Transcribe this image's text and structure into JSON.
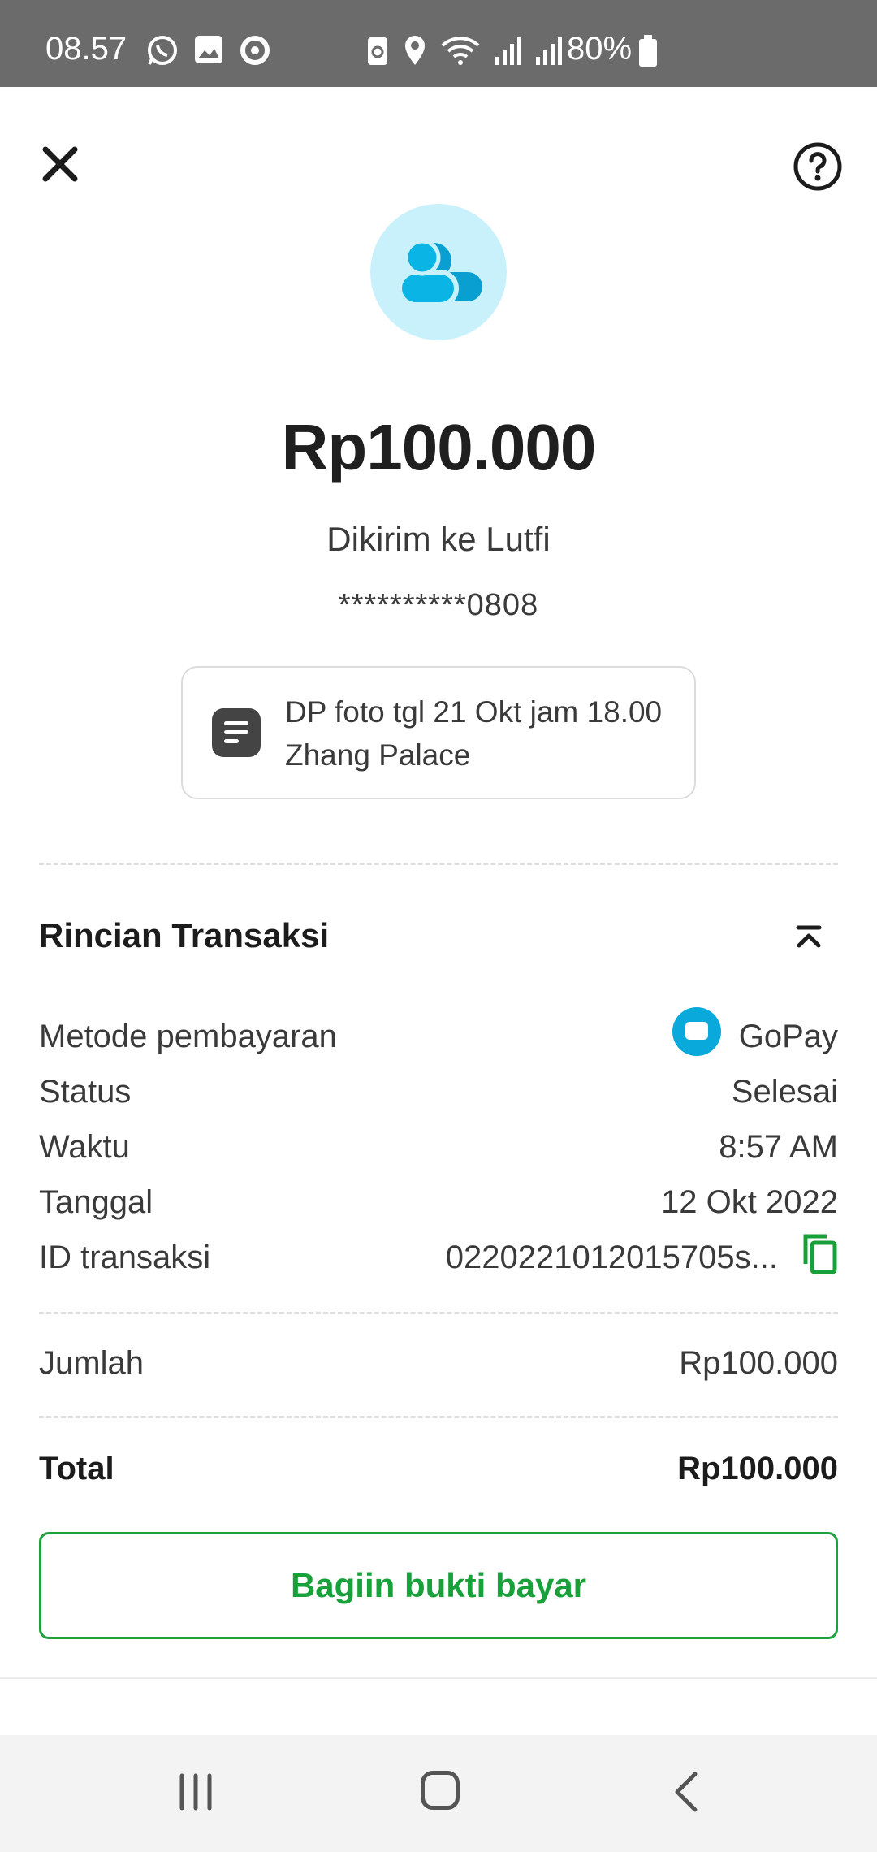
{
  "status_bar": {
    "time": "08.57",
    "battery": "80%",
    "icons_left": [
      "whatsapp-icon",
      "gallery-icon",
      "app-icon"
    ],
    "icons_right": [
      "recycle-icon",
      "location-icon",
      "wifi-icon",
      "signal-icon",
      "signal-icon"
    ]
  },
  "header": {
    "close_icon": "close-icon",
    "help_icon": "help-icon"
  },
  "transaction": {
    "amount": "Rp100.000",
    "recipient": "Dikirim ke Lutfi",
    "account": "**********0808",
    "note": "DP foto tgl 21 Okt jam 18.00 Zhang Palace"
  },
  "details": {
    "title": "Rincian Transaksi",
    "rows": [
      {
        "label": "Metode pembayaran",
        "value": "GoPay"
      },
      {
        "label": "Status",
        "value": "Selesai"
      },
      {
        "label": "Waktu",
        "value": "8:57 AM"
      },
      {
        "label": "Tanggal",
        "value": "12 Okt 2022"
      },
      {
        "label": "ID transaksi",
        "value": "0220221012015705s..."
      }
    ],
    "amount_label": "Jumlah",
    "amount_value": "Rp100.000",
    "total_label": "Total",
    "total_value": "Rp100.000"
  },
  "actions": {
    "share_label": "Bagiin bukti bayar"
  },
  "colors": {
    "accent_green": "#18a13a",
    "gopay_blue": "#0aa9dc",
    "avatar_bg": "#c9f1fb",
    "status_bar_bg": "#6b6b6b"
  }
}
